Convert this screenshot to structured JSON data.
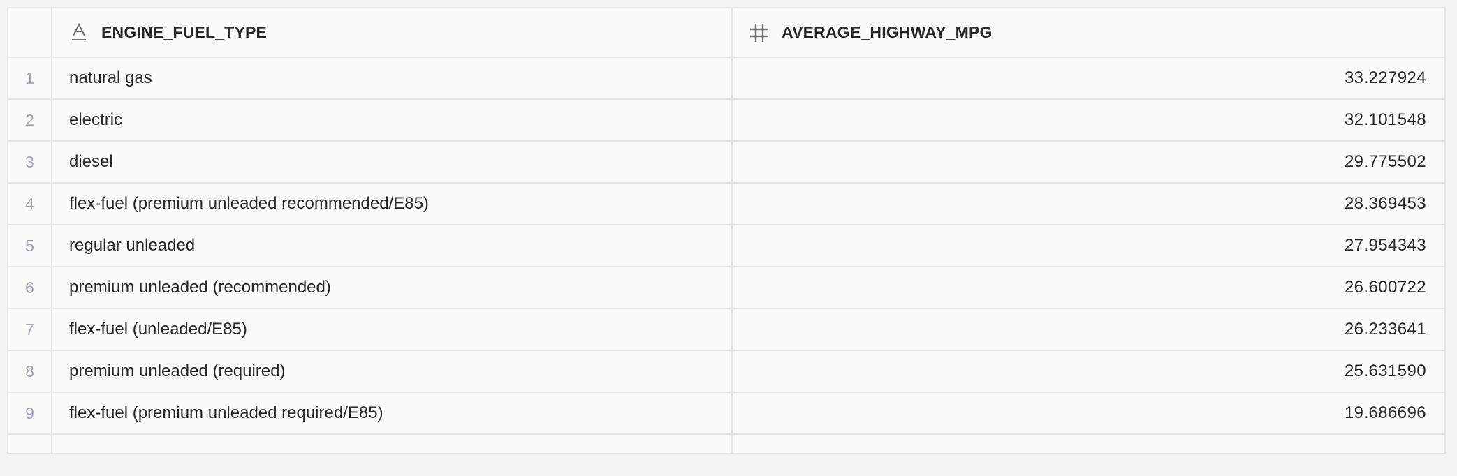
{
  "table": {
    "columns": [
      {
        "name": "ENGINE_FUEL_TYPE",
        "type_icon": "text-type-icon"
      },
      {
        "name": "AVERAGE_HIGHWAY_MPG",
        "type_icon": "number-type-icon"
      }
    ],
    "rows": [
      {
        "index": "1",
        "fuel_type": "natural gas",
        "avg_mpg": "33.227924"
      },
      {
        "index": "2",
        "fuel_type": "electric",
        "avg_mpg": "32.101548"
      },
      {
        "index": "3",
        "fuel_type": "diesel",
        "avg_mpg": "29.775502"
      },
      {
        "index": "4",
        "fuel_type": "flex-fuel (premium unleaded recommended/E85)",
        "avg_mpg": "28.369453"
      },
      {
        "index": "5",
        "fuel_type": "regular unleaded",
        "avg_mpg": "27.954343"
      },
      {
        "index": "6",
        "fuel_type": "premium unleaded (recommended)",
        "avg_mpg": "26.600722"
      },
      {
        "index": "7",
        "fuel_type": "flex-fuel (unleaded/E85)",
        "avg_mpg": "26.233641"
      },
      {
        "index": "8",
        "fuel_type": "premium unleaded (required)",
        "avg_mpg": "25.631590"
      },
      {
        "index": "9",
        "fuel_type": "flex-fuel (premium unleaded required/E85)",
        "avg_mpg": "19.686696"
      }
    ]
  },
  "colors": {
    "header_icon": "#71717a",
    "row_index": "#a1a1b5",
    "border": "#e4e4e7"
  }
}
